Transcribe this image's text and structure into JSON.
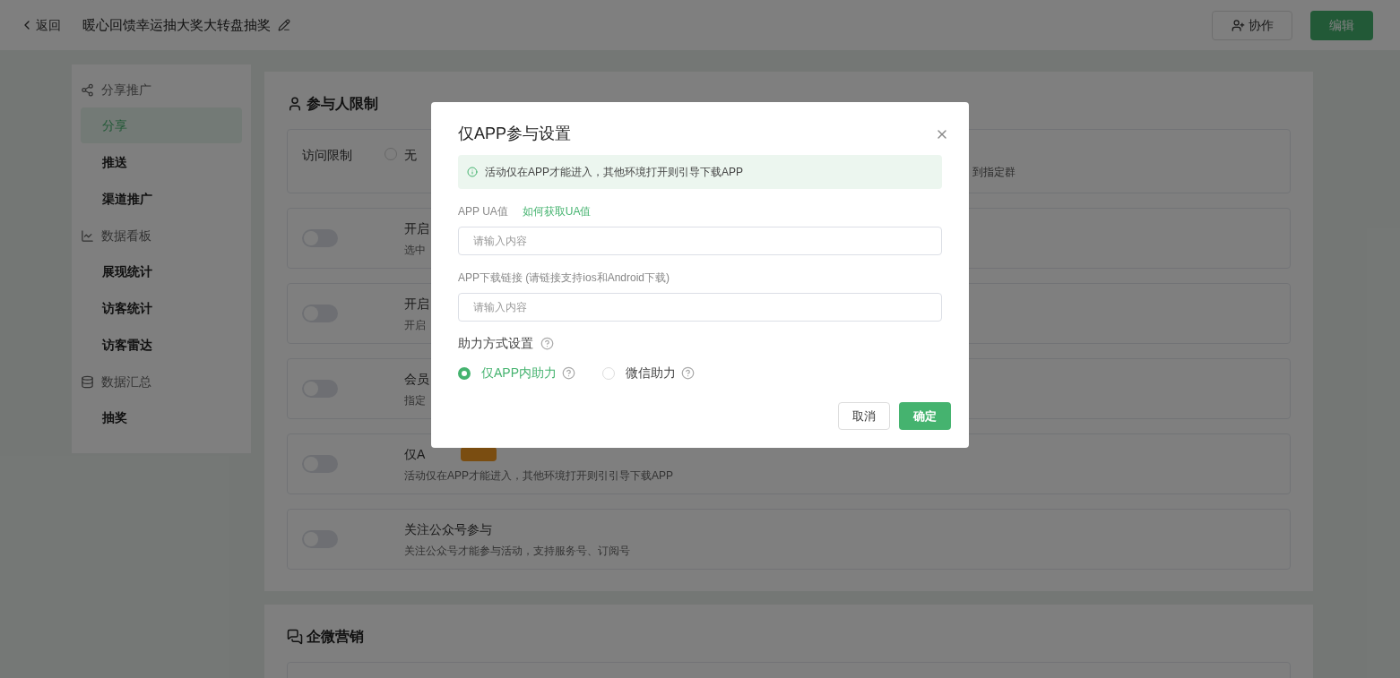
{
  "header": {
    "back": "返回",
    "title": "暖心回馈幸运抽大奖大转盘抽奖",
    "actions": [
      {
        "label": "协作",
        "kind": "outline"
      },
      {
        "label": "编辑",
        "kind": "primary"
      }
    ]
  },
  "sidebar": {
    "groups": [
      {
        "label": "分享推广",
        "kind": "share",
        "items": [
          {
            "label": "分享",
            "selected": true
          },
          {
            "label": "推送",
            "selected": false
          },
          {
            "label": "渠道推广",
            "selected": false
          }
        ]
      },
      {
        "label": "数据看板",
        "kind": "chart",
        "items": [
          {
            "label": "展现统计",
            "selected": false
          },
          {
            "label": "访客统计",
            "selected": false
          },
          {
            "label": "访客雷达",
            "selected": false
          }
        ]
      },
      {
        "label": "数据汇总",
        "kind": "database",
        "items": [
          {
            "label": "抽奖",
            "selected": false
          }
        ]
      }
    ]
  },
  "sections": [
    {
      "title": "参与人限制",
      "kind": "user",
      "rows": [
        {
          "kind": "radio",
          "label": "访问限制",
          "options": [
            {
              "label": "无",
              "selected": false
            }
          ],
          "note": "到指定群"
        },
        {
          "kind": "toggle",
          "on": false,
          "title": "开启",
          "desc": "选中"
        },
        {
          "kind": "toggle",
          "on": false,
          "title": "开启",
          "desc": "开启"
        },
        {
          "kind": "toggle",
          "on": false,
          "title": "会员",
          "desc": "指定"
        },
        {
          "kind": "toggle",
          "on": false,
          "title": "仅A",
          "desc": "活动仅在APP才能进入，其他环境打开则引引导下载APP",
          "badge": true
        },
        {
          "kind": "toggle",
          "on": false,
          "title": "关注公众号参与",
          "desc": "关注公众号才能参与活动，支持服务号、订阅号",
          "badge": false
        }
      ]
    },
    {
      "title": "企微营销",
      "kind": "chat"
    }
  ],
  "dialog": {
    "title": "仅APP参与设置",
    "alert": "活动仅在APP才能进入，其他环境打开则引导下载APP",
    "fields": [
      {
        "label": "APP UA值",
        "link": "如何获取UA值",
        "placeholder": "请输入内容"
      },
      {
        "label": "APP下载链接 (请链接支持ios和Android下载)",
        "placeholder": "请输入内容"
      }
    ],
    "assist": {
      "label": "助力方式设置",
      "options": [
        {
          "label": "仅APP内助力",
          "selected": true
        },
        {
          "label": "微信助力",
          "selected": false
        }
      ]
    },
    "buttons": [
      {
        "label": "取消",
        "kind": "outline"
      },
      {
        "label": "确定",
        "kind": "primary"
      }
    ]
  }
}
